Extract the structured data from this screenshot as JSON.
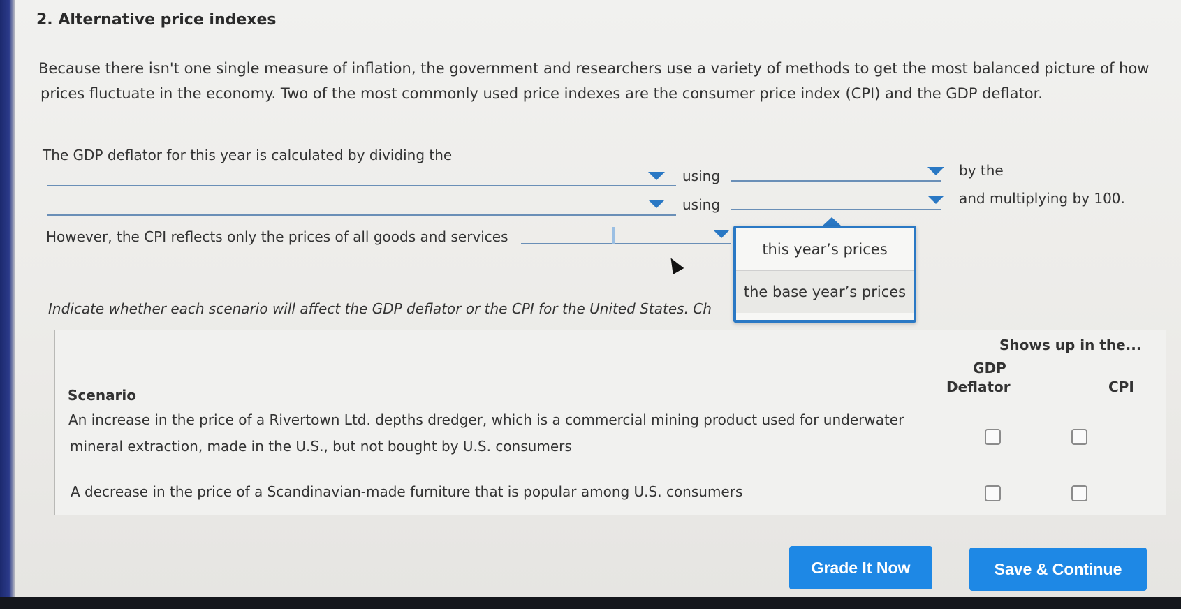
{
  "title": "2. Alternative price indexes",
  "intro": {
    "line1": "Because there isn't one single measure of inflation, the government and researchers use a variety of methods to get the most balanced picture of how",
    "line2": "prices fluctuate in the economy. Two of the most commonly used price indexes are the consumer price index (CPI) and the GDP deflator."
  },
  "gdp_sentence": {
    "lead": "The GDP deflator for this year is calculated by dividing the",
    "using1": "using",
    "by_the": "by the",
    "using2": "using",
    "tail": "and multiplying by 100."
  },
  "cpi_sentence": {
    "lead": "However, the CPI reflects only the prices of all goods and services"
  },
  "dropdown": {
    "options": [
      "this year’s prices",
      "the base year’s prices"
    ]
  },
  "instruction": "Indicate whether each scenario will affect the GDP deflator or the CPI for the United States. Ch",
  "table": {
    "group_header": "Shows up in the...",
    "col_scenario": "Scenario",
    "col_gdp_line1": "GDP",
    "col_gdp_line2": "Deflator",
    "col_cpi": "CPI",
    "rows": [
      {
        "line1": "An increase in the price of a Rivertown Ltd. depths dredger, which is a commercial mining product used for underwater",
        "line2": "mineral extraction, made in the U.S., but not bought by U.S. consumers",
        "gdp": false,
        "cpi": false
      },
      {
        "line1": "A decrease in the price of a Scandinavian-made furniture that is popular among U.S. consumers",
        "gdp": false,
        "cpi": false
      }
    ]
  },
  "buttons": {
    "grade": "Grade It Now",
    "save": "Save & Continue"
  },
  "colors": {
    "accent": "#1e88e5",
    "dropdown_border": "#2a78c4"
  }
}
